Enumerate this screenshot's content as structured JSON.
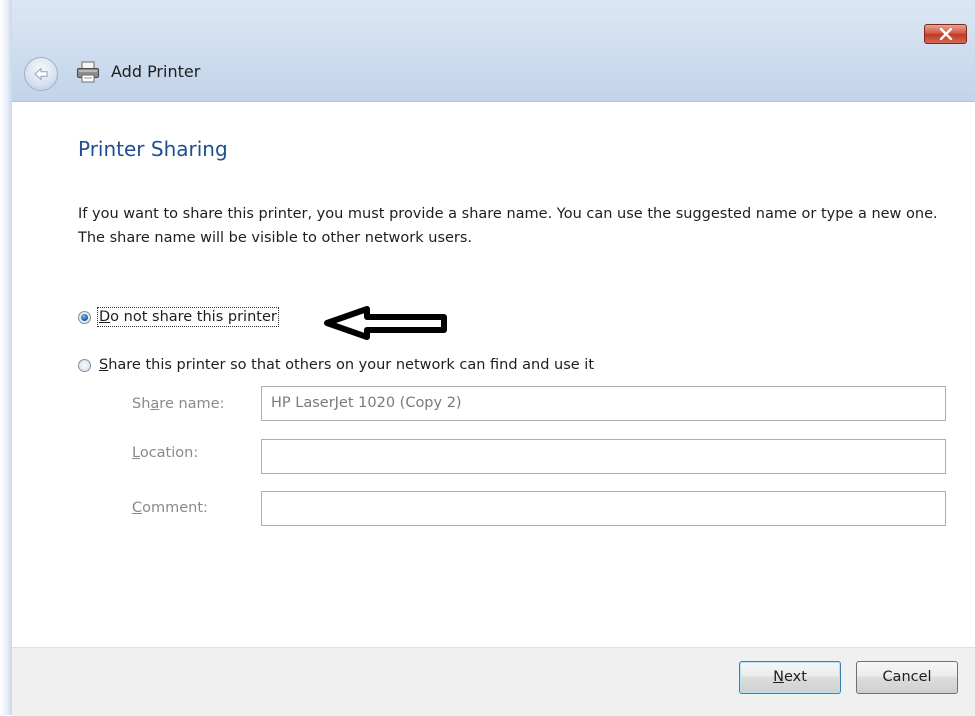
{
  "window": {
    "title": "Add Printer",
    "icons": {
      "back": "back-arrow-icon",
      "printer": "printer-icon",
      "close": "close-icon"
    }
  },
  "page": {
    "heading": "Printer Sharing",
    "description": "If you want to share this printer, you must provide a share name. You can use the suggested name or type a new one. The share name will be visible to other network users."
  },
  "options": {
    "do_not_share": {
      "mnemonic": "D",
      "label_rest": "o not share this printer",
      "selected": true
    },
    "share": {
      "mnemonic": "S",
      "label_rest": "hare this printer so that others on your network can find and use it",
      "selected": false
    }
  },
  "fields": {
    "share_name": {
      "label_pre": "Sh",
      "mnemonic": "a",
      "label_post": "re name:",
      "value": "HP LaserJet 1020 (Copy 2)"
    },
    "location": {
      "label_pre": "",
      "mnemonic": "L",
      "label_post": "ocation:",
      "value": ""
    },
    "comment": {
      "label_pre": "",
      "mnemonic": "C",
      "label_post": "omment:",
      "value": ""
    }
  },
  "buttons": {
    "next": {
      "mnemonic": "N",
      "label_rest": "ext"
    },
    "cancel": {
      "label": "Cancel"
    }
  },
  "colors": {
    "heading": "#1f4f8f",
    "disabled_text": "#8a8a8a",
    "close_button": "#c23620"
  }
}
